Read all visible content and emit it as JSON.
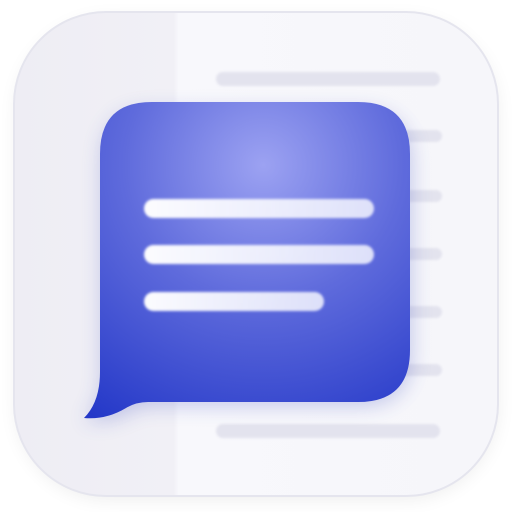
{
  "icon": {
    "name": "chat-bubble-message-app-icon",
    "colors": {
      "tile_left": "#efeef5",
      "tile_right": "#f7f7fb",
      "tile_border": "#e6e6ee",
      "bubble_light": "#9a9ff0",
      "bubble_mid": "#5d69d8",
      "bubble_dark": "#2a3fcb",
      "text_line": "#ffffff",
      "doc_line": "#e4e4ee"
    }
  }
}
